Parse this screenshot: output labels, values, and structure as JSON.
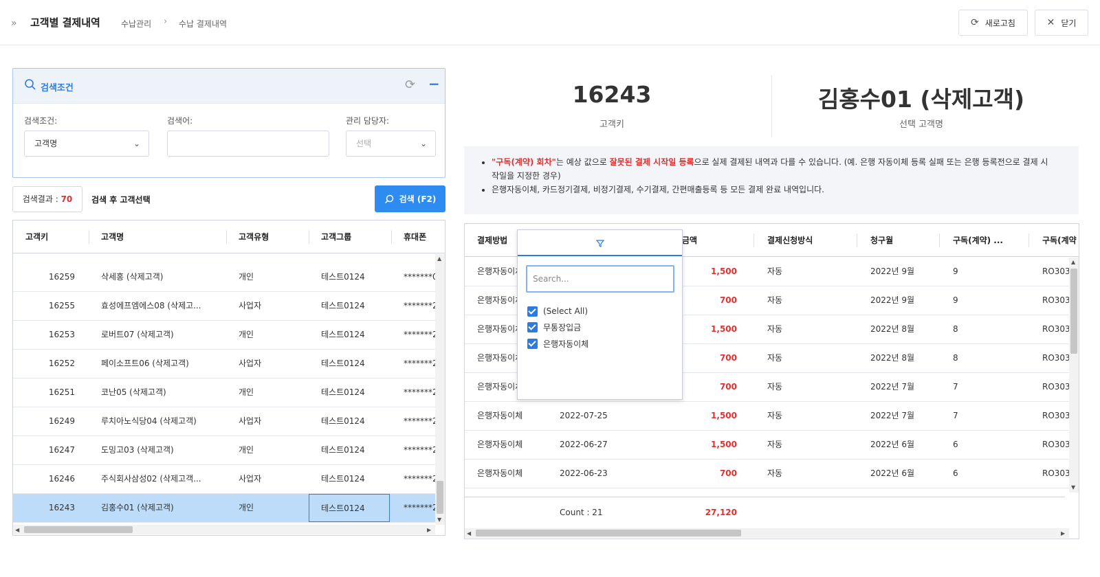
{
  "header": {
    "title": "고객별 결제내역",
    "breadcrumb": [
      "수납관리",
      "수납 결제내역"
    ],
    "refresh_label": "새로고침",
    "close_label": "닫기"
  },
  "search_panel": {
    "title": "검색조건",
    "condition_label": "검색조건:",
    "condition_value": "고객명",
    "keyword_label": "검색어:",
    "keyword_value": "",
    "manager_label": "관리 담당자:",
    "manager_placeholder": "선택",
    "result_label": "검색결과 : ",
    "result_count": "70",
    "result_hint": "검색 후 고객선택",
    "search_button": "검색 (F2)"
  },
  "customer_grid": {
    "columns": [
      "고객키",
      "고객명",
      "고객유형",
      "고객그룹",
      "휴대폰"
    ],
    "rows": [
      [
        "16259",
        "삭세홍 (삭제고객)",
        "개인",
        "테스트0124",
        "*******0"
      ],
      [
        "16255",
        "효성에프엠에스08 (삭제고...",
        "사업자",
        "테스트0124",
        "*******2"
      ],
      [
        "16253",
        "로버트07 (삭제고객)",
        "개인",
        "테스트0124",
        "*******2"
      ],
      [
        "16252",
        "페이소프트06 (삭제고객)",
        "사업자",
        "테스트0124",
        "*******2"
      ],
      [
        "16251",
        "코난05 (삭제고객)",
        "개인",
        "테스트0124",
        "*******2"
      ],
      [
        "16249",
        "루치아노식당04 (삭제고객)",
        "사업자",
        "테스트0124",
        "*******2"
      ],
      [
        "16247",
        "도밍고03 (삭제고객)",
        "개인",
        "테스트0124",
        "*******2"
      ],
      [
        "16246",
        "주식회사삼성02 (삭제고객...",
        "사업자",
        "테스트0124",
        "*******2"
      ],
      [
        "16243",
        "김홍수01 (삭제고객)",
        "개인",
        "테스트0124",
        "*******2"
      ]
    ],
    "selected_index": 8
  },
  "summary": {
    "customer_key": "16243",
    "customer_key_label": "고객키",
    "customer_name": "김홍수01 (삭제고객)",
    "customer_name_label": "선택 고객명"
  },
  "notice": {
    "line1_q": "\"구독(계약) 회차\"",
    "line1_a": "는 예상 값으로 ",
    "line1_red": "잘못된 결제 시작일 등록",
    "line1_b": "으로 실제 결제된 내역과 다를 수 있습니다. (예. 은행 자동이체 등록 실패 또는 은행 등록전으로 결제 시작일을 지정한 경우)",
    "line2": "은행자동이체, 카드정기결제, 비정기결제, 수기결제, 간편매출등록 등 모든 결제 완료 내역입니다."
  },
  "payment_grid": {
    "columns": [
      "결제방법",
      "",
      "금액",
      "결제신청방식",
      "청구월",
      "구독(계약) ...",
      "구독(계약"
    ],
    "rows": [
      [
        "은행자동이체",
        "",
        "1,500",
        "자동",
        "2022년 9월",
        "9",
        "RO303"
      ],
      [
        "은행자동이체",
        "",
        "700",
        "자동",
        "2022년 9월",
        "9",
        "RO303"
      ],
      [
        "은행자동이체",
        "",
        "1,500",
        "자동",
        "2022년 8월",
        "8",
        "RO303"
      ],
      [
        "은행자동이체",
        "",
        "700",
        "자동",
        "2022년 8월",
        "8",
        "RO303"
      ],
      [
        "은행자동이체",
        "",
        "700",
        "자동",
        "2022년 7월",
        "7",
        "RO303"
      ],
      [
        "은행자동이체",
        "2022-07-25",
        "1,500",
        "자동",
        "2022년 7월",
        "7",
        "RO303"
      ],
      [
        "은행자동이체",
        "2022-06-27",
        "1,500",
        "자동",
        "2022년 6월",
        "6",
        "RO303"
      ],
      [
        "은행자동이체",
        "2022-06-23",
        "700",
        "자동",
        "2022년 6월",
        "6",
        "RO303"
      ]
    ],
    "footer_count": "Count : 21",
    "footer_total": "27,120"
  },
  "filter_popup": {
    "search_placeholder": "Search...",
    "items": [
      "(Select All)",
      "무통장입금",
      "은행자동이체"
    ]
  },
  "colors": {
    "accent": "#2e8cf0",
    "amount": "#e03131",
    "selected_row": "#bcdcf9"
  }
}
